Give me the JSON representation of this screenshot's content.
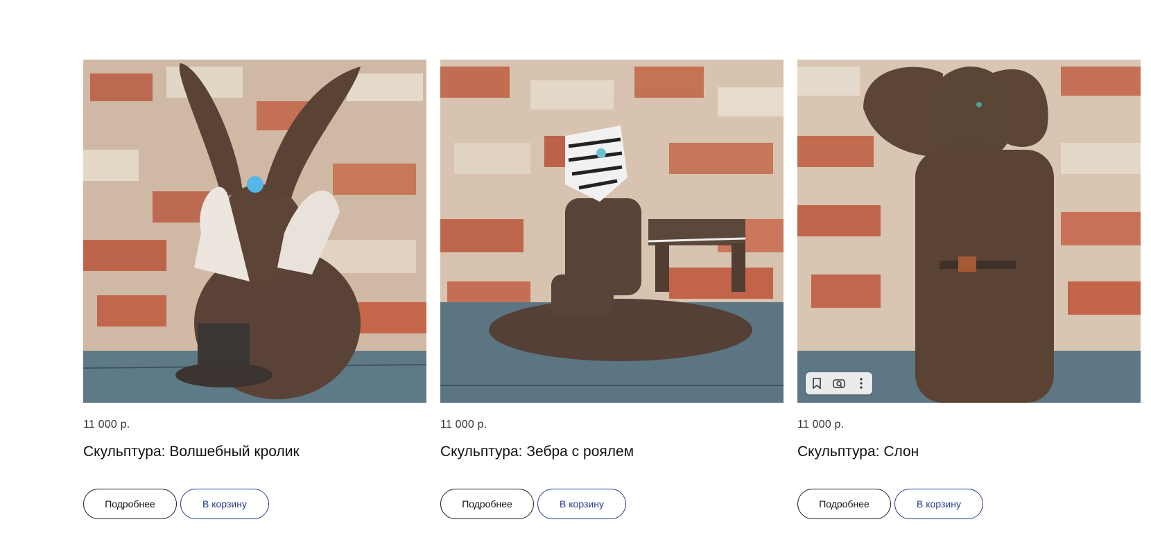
{
  "products": [
    {
      "price": "11 000 р.",
      "title": "Скульптура: Волшебный кролик",
      "more_label": "Подробнее",
      "cart_label": "В корзину",
      "icon": "rabbit-sculpture"
    },
    {
      "price": "11 000 р.",
      "title": "Скульптура: Зебра с роялем",
      "more_label": "Подробнее",
      "cart_label": "В корзину",
      "icon": "zebra-piano-sculpture"
    },
    {
      "price": "11 000 р.",
      "title": "Скульптура: Слон",
      "more_label": "Подробнее",
      "cart_label": "В корзину",
      "icon": "elephant-sculpture"
    }
  ],
  "image_toolbar": {
    "icons": [
      "bookmark-icon",
      "lens-search-icon",
      "more-vert-icon"
    ]
  },
  "colors": {
    "cart_accent": "#233a8c",
    "text": "#111111"
  }
}
